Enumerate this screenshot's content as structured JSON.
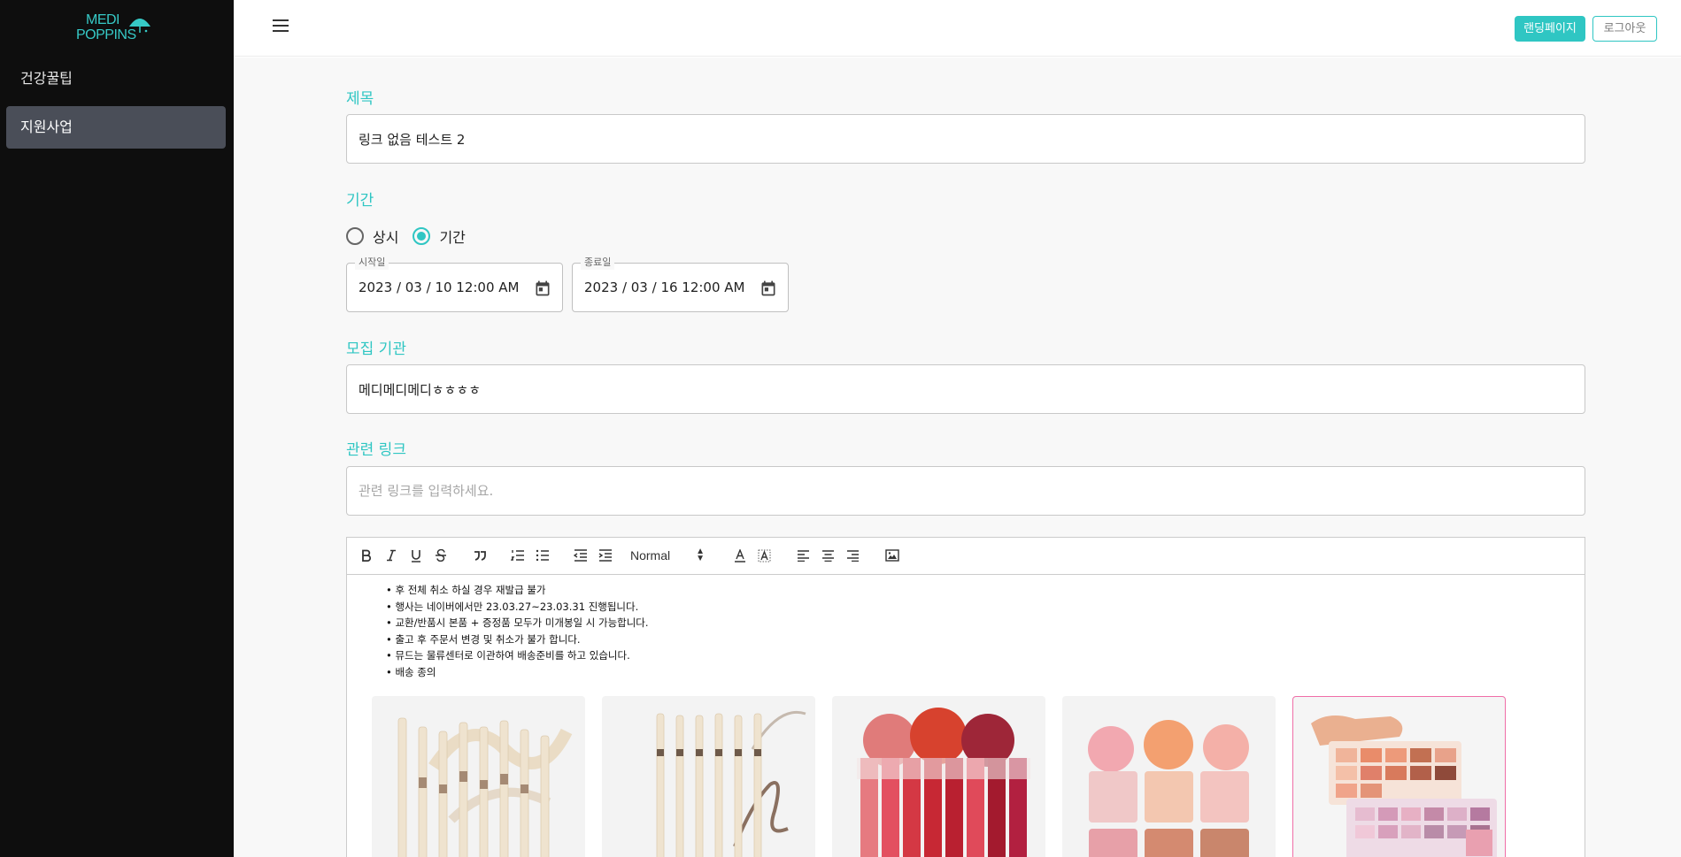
{
  "brand": {
    "line1": "MEDI",
    "line2": "POPPINS"
  },
  "sidebar": {
    "items": [
      {
        "label": "건강꿀팁",
        "active": false
      },
      {
        "label": "지원사업",
        "active": true
      }
    ]
  },
  "header": {
    "landing_label": "랜딩페이지",
    "logout_label": "로그아웃"
  },
  "form": {
    "title": {
      "label": "제목",
      "value": "링크 없음 테스트 2"
    },
    "period": {
      "label": "기간",
      "options": [
        {
          "label": "상시",
          "checked": false
        },
        {
          "label": "기간",
          "checked": true
        }
      ],
      "start": {
        "legend": "시작일",
        "value": "2023 / 03 / 10 12:00 AM"
      },
      "end": {
        "legend": "종료일",
        "value": "2023 / 03 / 16 12:00 AM"
      }
    },
    "org": {
      "label": "모집 기관",
      "value": "메디메디메디ㅎㅎㅎㅎ"
    },
    "link": {
      "label": "관련 링크",
      "value": "",
      "placeholder": "관련 링크를 입력하세요."
    }
  },
  "editor": {
    "heading_select": "Normal",
    "toolbar_icons": [
      "bold-icon",
      "italic-icon",
      "underline-icon",
      "strike-icon",
      "blockquote-icon",
      "ordered-list-icon",
      "bullet-list-icon",
      "outdent-icon",
      "indent-icon",
      "font-color-icon",
      "background-color-icon",
      "align-left-icon",
      "align-center-icon",
      "align-right-icon",
      "image-icon"
    ],
    "bullets": [
      "후 전체 취소 하실 경우 재발급 불가",
      "행사는 네이버에서만 23.03.27~23.03.31 진행됩니다.",
      "교환/반품시 본품 + 증정품 모두가 미개봉일 시 가능합니다.",
      "출고 후 주문서 변경 및 취소가 불가 합니다.",
      "뮤드는 물류센터로 이관하여 배송준비를 하고 있습니다.",
      "배송 종의"
    ],
    "images": [
      {
        "name": "eyeliner-pencils-image",
        "selected": false
      },
      {
        "name": "brow-pencils-image",
        "selected": false
      },
      {
        "name": "lip-tints-image",
        "selected": false
      },
      {
        "name": "blush-compacts-image",
        "selected": false
      },
      {
        "name": "eyeshadow-palettes-image",
        "selected": true
      }
    ]
  },
  "colors": {
    "accent": "#2fc6c3",
    "sidebar": "#0e0e0e",
    "active_nav": "#4a4e58",
    "selected_border": "#f06ea8"
  }
}
